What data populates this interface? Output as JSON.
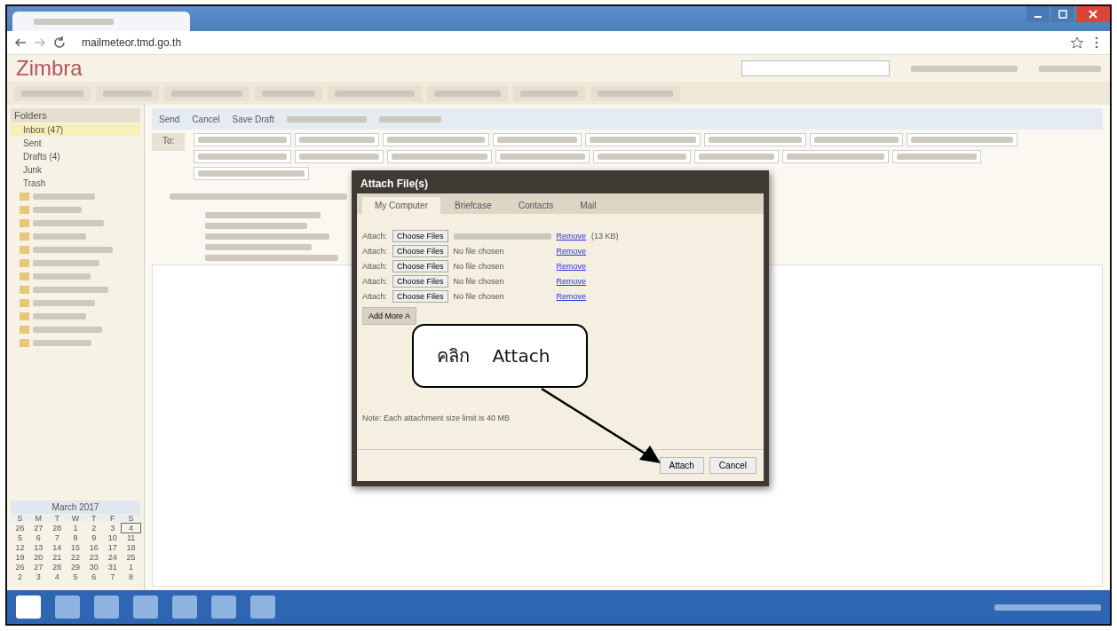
{
  "browser": {
    "url": "mailmeteor.tmd.go.th"
  },
  "app": {
    "logo": "Zimbra"
  },
  "sidebar": {
    "header": "Folders",
    "folders": [
      {
        "name": "Inbox (47)",
        "selected": true
      },
      {
        "name": "Sent",
        "selected": false
      },
      {
        "name": "Drafts (4)",
        "selected": false
      },
      {
        "name": "Junk",
        "selected": false
      },
      {
        "name": "Trash",
        "selected": false
      }
    ]
  },
  "calendar": {
    "month": "March 2017",
    "weekdays": [
      "S",
      "M",
      "T",
      "W",
      "T",
      "F",
      "S"
    ],
    "weeks": [
      [
        {
          "d": "26",
          "selected": false
        },
        {
          "d": "27",
          "selected": false
        },
        {
          "d": "28",
          "selected": false
        },
        {
          "d": "1",
          "selected": false
        },
        {
          "d": "2",
          "selected": false
        },
        {
          "d": "3",
          "selected": false
        },
        {
          "d": "4",
          "selected": true
        }
      ],
      [
        {
          "d": "5",
          "selected": false
        },
        {
          "d": "6",
          "selected": false
        },
        {
          "d": "7",
          "selected": false
        },
        {
          "d": "8",
          "selected": false
        },
        {
          "d": "9",
          "selected": false
        },
        {
          "d": "10",
          "selected": false
        },
        {
          "d": "11",
          "selected": false
        }
      ],
      [
        {
          "d": "12",
          "selected": false
        },
        {
          "d": "13",
          "selected": false
        },
        {
          "d": "14",
          "selected": false
        },
        {
          "d": "15",
          "selected": false
        },
        {
          "d": "16",
          "selected": false
        },
        {
          "d": "17",
          "selected": false
        },
        {
          "d": "18",
          "selected": false
        }
      ],
      [
        {
          "d": "19",
          "selected": false
        },
        {
          "d": "20",
          "selected": false
        },
        {
          "d": "21",
          "selected": false
        },
        {
          "d": "22",
          "selected": false
        },
        {
          "d": "23",
          "selected": false
        },
        {
          "d": "24",
          "selected": false
        },
        {
          "d": "25",
          "selected": false
        }
      ],
      [
        {
          "d": "26",
          "selected": false
        },
        {
          "d": "27",
          "selected": false
        },
        {
          "d": "28",
          "selected": false
        },
        {
          "d": "29",
          "selected": false
        },
        {
          "d": "30",
          "selected": false
        },
        {
          "d": "31",
          "selected": false
        },
        {
          "d": "1",
          "selected": false
        }
      ],
      [
        {
          "d": "2",
          "selected": false
        },
        {
          "d": "3",
          "selected": false
        },
        {
          "d": "4",
          "selected": false
        },
        {
          "d": "5",
          "selected": false
        },
        {
          "d": "6",
          "selected": false
        },
        {
          "d": "7",
          "selected": false
        },
        {
          "d": "8",
          "selected": false
        }
      ]
    ]
  },
  "compose": {
    "toolbar": [
      "Send",
      "Cancel",
      "Save Draft"
    ],
    "to_button": "To:"
  },
  "dialog": {
    "title": "Attach File(s)",
    "tabs": [
      {
        "label": "My Computer",
        "selected": true
      },
      {
        "label": "Briefcase",
        "selected": false
      },
      {
        "label": "Contacts",
        "selected": false
      },
      {
        "label": "Mail",
        "selected": false
      }
    ],
    "rows": [
      {
        "label": "Attach:",
        "button": "Choose Files",
        "kind": "chosen",
        "remove": "Remove",
        "size": "(13 KB)"
      },
      {
        "label": "Attach:",
        "button": "Choose Files",
        "kind": "empty",
        "status": "No file chosen",
        "remove": "Remove"
      },
      {
        "label": "Attach:",
        "button": "Choose Files",
        "kind": "empty",
        "status": "No file chosen",
        "remove": "Remove"
      },
      {
        "label": "Attach:",
        "button": "Choose Files",
        "kind": "empty",
        "status": "No file chosen",
        "remove": "Remove"
      },
      {
        "label": "Attach:",
        "button": "Choose Files",
        "kind": "empty",
        "status": "No file chosen",
        "remove": "Remove"
      }
    ],
    "add_more": "Add More A",
    "note": "Note: Each attachment size limit is 40 MB",
    "buttons": [
      "Attach",
      "Cancel"
    ]
  },
  "callout": {
    "text": "คลิก    Attach"
  }
}
